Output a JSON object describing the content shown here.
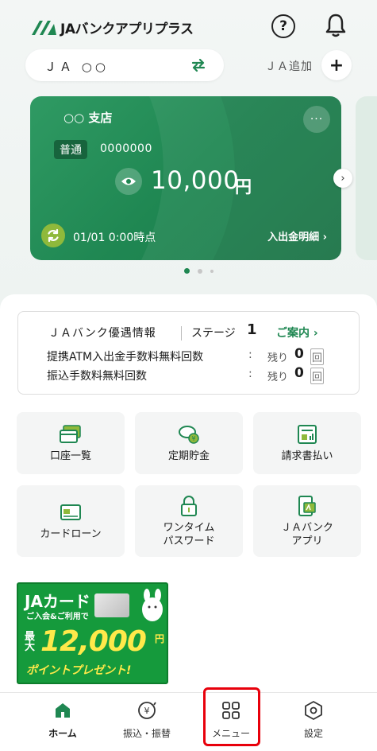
{
  "header": {
    "logo_text": "JAバンクアプリプラス",
    "help_label": "?",
    "brand_color": "#1f8752"
  },
  "ja_selector": {
    "label": "ＪＡ ○○",
    "add_label": "ＪＡ追加",
    "add_icon": "+"
  },
  "account_card": {
    "branch": "○○ 支店",
    "more_icon": "···",
    "type": "普通",
    "account_number": "0000000",
    "balance": "10,000",
    "currency": "円",
    "updated": "01/01 0:00時点",
    "detail_link": "入出金明細 ›",
    "next_icon": "›",
    "page_count": 3,
    "active_page": 1
  },
  "info": {
    "title": "ＪＡバンク優遇情報",
    "stage_label": "ステージ",
    "stage_value": "1",
    "guide_link": "ご案内 ›",
    "rows": [
      {
        "label": "提携ATM入出金手数料無料回数",
        "colon": ":",
        "remain": "残り",
        "count": "0",
        "unit": "回"
      },
      {
        "label": "振込手数料無料回数",
        "colon": ":",
        "remain": "残り",
        "count": "0",
        "unit": "回"
      }
    ]
  },
  "tiles": [
    {
      "label": "口座一覧",
      "icon": "cards-icon"
    },
    {
      "label": "定期貯金",
      "icon": "piggy-bank-icon"
    },
    {
      "label": "請求書払い",
      "icon": "invoice-icon"
    },
    {
      "label": "カードローン",
      "icon": "credit-card-icon"
    },
    {
      "label": "ワンタイム\nパスワード",
      "icon": "lock-icon"
    },
    {
      "label": "ＪＡバンク\nアプリ",
      "icon": "phone-app-icon"
    }
  ],
  "banner": {
    "title": "JAカード",
    "subtitle": "ご入会&ご利用で",
    "max": "最大",
    "amount": "12,000",
    "amount_unit": "円",
    "bottom": "ポイントプレゼント!"
  },
  "bottom_nav": [
    {
      "label": "ホーム",
      "icon": "home-icon",
      "active": true
    },
    {
      "label": "振込・振替",
      "icon": "transfer-icon",
      "active": false
    },
    {
      "label": "メニュー",
      "icon": "menu-grid-icon",
      "active": false
    },
    {
      "label": "設定",
      "icon": "settings-icon",
      "active": false
    }
  ]
}
